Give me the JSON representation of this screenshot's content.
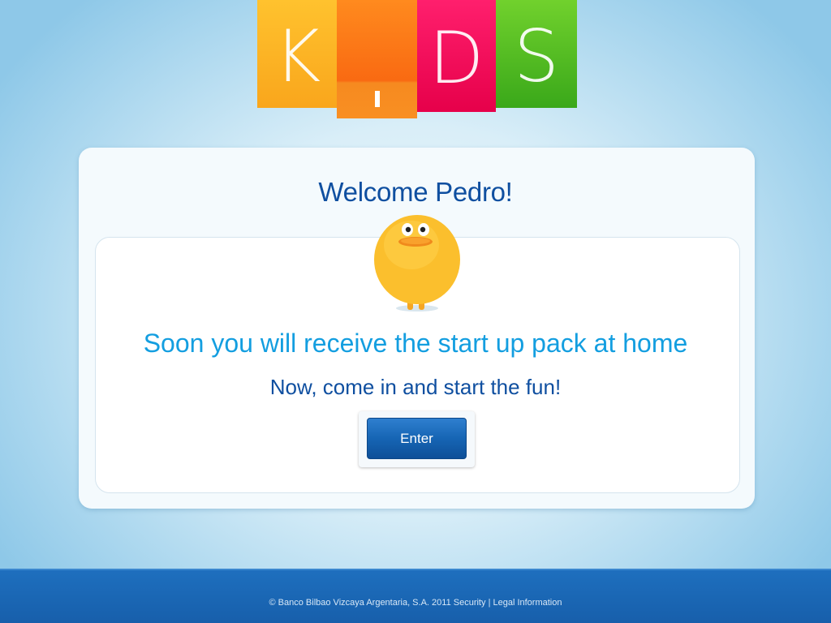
{
  "logo": {
    "letters": [
      "K",
      "i",
      "D",
      "S"
    ],
    "colors": [
      "#f9b51f",
      "#f97316",
      "#f50a5a",
      "#4cbb22"
    ]
  },
  "panel": {
    "welcome": "Welcome Pedro!",
    "headline": "Soon you will receive the start up pack at home",
    "subline": "Now, come in and start the fun!",
    "enter_label": "Enter"
  },
  "mascot": {
    "icon": "yellow-blob-mascot"
  },
  "footer": {
    "copyright": "© Banco Bilbao Vizcaya Argentaria, S.A. 2011",
    "security": "Security",
    "separator": "|",
    "legal": "Legal Information"
  },
  "colors": {
    "headline": "#139ee0",
    "title": "#0f4fa0",
    "button": "#1665b4",
    "footer": "#1a65b3"
  }
}
